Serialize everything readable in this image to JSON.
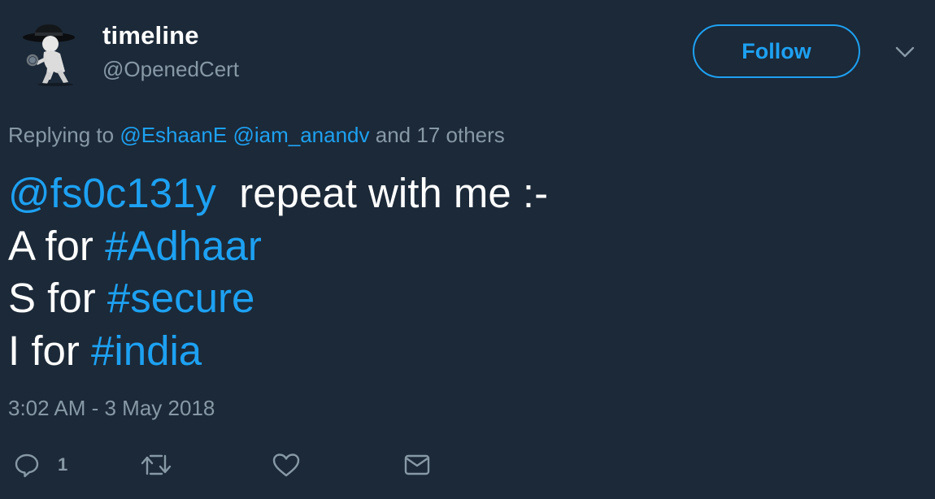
{
  "user": {
    "name": "timeline",
    "handle": "@OpenedCert",
    "avatar_icon": "detective-figure-avatar"
  },
  "follow_button": {
    "label": "Follow"
  },
  "menu_icon": "chevron-down-icon",
  "replying": {
    "prefix": "Replying to",
    "mention1": "@EshaanE",
    "mention2": "@iam_anandv",
    "suffix": "and 17 others"
  },
  "tweet": {
    "line1_mention": "@fs0c131y",
    "line1_text": "repeat with me :-",
    "line2_text": "A for",
    "line2_tag": "#Adhaar",
    "line3_text": "S for",
    "line3_tag": "#secure",
    "line4_text": "I for",
    "line4_tag": "#india"
  },
  "timestamp": "3:02 AM - 3 May 2018",
  "actions": {
    "reply_count": "1",
    "icons": [
      "reply-icon",
      "retweet-icon",
      "like-icon",
      "direct-message-icon"
    ]
  },
  "colors": {
    "background": "#1c2938",
    "accent": "#1da1f2",
    "muted": "#8899a6",
    "text": "#ffffff"
  }
}
